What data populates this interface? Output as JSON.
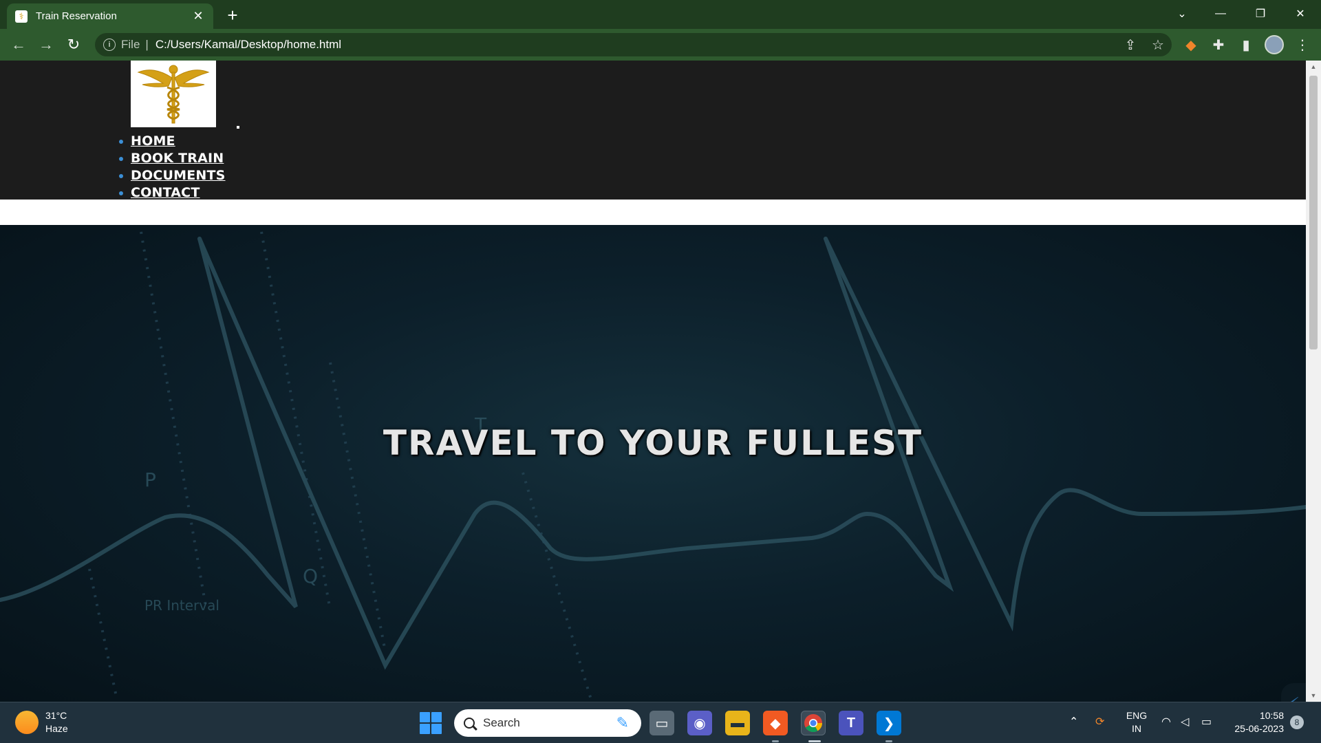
{
  "browser": {
    "tab_title": "Train Reservation",
    "scheme_label": "File",
    "url": "C:/Users/Kamal/Desktop/home.html"
  },
  "site": {
    "nav": [
      {
        "label": "HOME"
      },
      {
        "label": "BOOK TRAIN"
      },
      {
        "label": "DOCUMENTS"
      },
      {
        "label": "CONTACT"
      }
    ],
    "hero_title": "TRAVEL TO YOUR FULLEST",
    "accent_color": "#d4a017",
    "bullet_color": "#3b8fd6"
  },
  "taskbar": {
    "weather_temp": "31°C",
    "weather_desc": "Haze",
    "search_label": "Search",
    "language_line1": "ENG",
    "language_line2": "IN",
    "time": "10:58",
    "date": "25-06-2023",
    "notification_count": "8"
  }
}
